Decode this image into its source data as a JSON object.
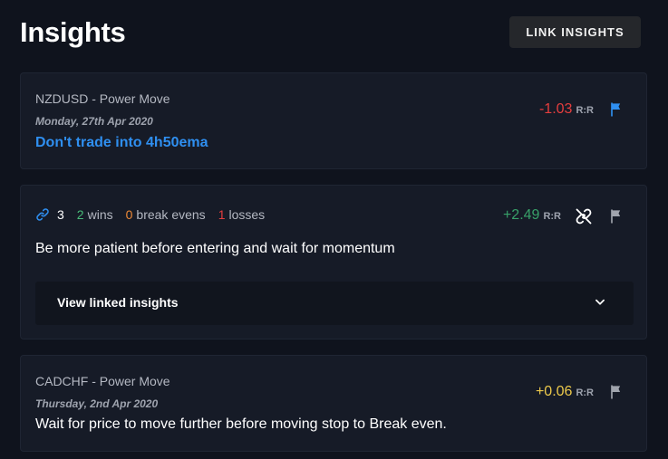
{
  "header": {
    "title": "Insights",
    "link_button_label": "LINK INSIGHTS"
  },
  "cards": [
    {
      "pair": "NZDUSD - Power Move",
      "date": "Monday, 27th Apr 2020",
      "text": "Don't trade into 4h50ema",
      "rr_value": "-1.03",
      "rr_unit": "R:R",
      "flag_color": "#2f8ff0"
    },
    {
      "linked_count": "3",
      "wins_num": "2",
      "wins_label": "wins",
      "breakevens_num": "0",
      "breakevens_label": "break evens",
      "losses_num": "1",
      "losses_label": "losses",
      "text": "Be more patient before entering and wait for momentum",
      "rr_value": "+2.49",
      "rr_unit": "R:R",
      "accordion_label": "View linked insights",
      "flag_color": "#a0a4ad"
    },
    {
      "pair": "CADCHF - Power Move",
      "date": "Thursday, 2nd Apr 2020",
      "text": "Wait for price to move further before moving stop to Break even.",
      "rr_value": "+0.06",
      "rr_unit": "R:R",
      "flag_color": "#a0a4ad"
    }
  ],
  "colors": {
    "background": "#0f131d",
    "card": "#161b27",
    "accent": "#2f8ff0",
    "negative": "#e53e3e",
    "positive": "#38a169",
    "neutral": "#ecc94b"
  }
}
